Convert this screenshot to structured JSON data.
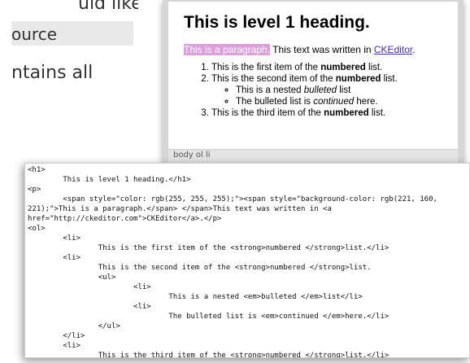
{
  "background_text": {
    "line1": "uld like to",
    "line2": "ource",
    "line3": "ntains all"
  },
  "editor": {
    "heading": "This is level 1 heading.",
    "para_highlight": "This is a paragraph.",
    "para_rest": " This text was written in ",
    "link_text": "CKEditor",
    "para_end": ".",
    "list": [
      {
        "pre": "This is the first item of the ",
        "strong": "numbered",
        "post": " list."
      },
      {
        "pre": "This is the second item of the ",
        "strong": "numbered",
        "post": " list."
      },
      {
        "pre": "This is the third item of the ",
        "strong": "numbered",
        "post": " list."
      }
    ],
    "nested": [
      {
        "pre": "This is a nested ",
        "em": "bulleted",
        "post": " list"
      },
      {
        "pre": "The bulleted list is ",
        "em": "continued",
        "post": " here."
      }
    ],
    "status": "body  ol  li",
    "colors": {
      "highlight": "#dda0dd",
      "link": "#4a2bbf"
    }
  },
  "source_code": "<h1>\n        This is level 1 heading.</h1>\n<p>\n        <span style=\"color: rgb(255, 255, 255);\"><span style=\"background-color: rgb(221, 160,\n221);\">This is a paragraph.</span> </span>This text was written in <a\nhref=\"http://ckeditor.com\">CKEditor</a>.</p>\n<ol>\n        <li>\n                This is the first item of the <strong>numbered </strong>list.</li>\n        <li>\n                This is the second item of the <strong>numbered </strong>list.\n                <ul>\n                        <li>\n                                This is a nested <em>bulleted </em>list</li>\n                        <li>\n                                The bulleted list is <em>continued </em>here.</li>\n                </ul>\n        </li>\n        <li>\n                This is the third item of the <strong>numbered </strong>list.</li>\n</ol>"
}
